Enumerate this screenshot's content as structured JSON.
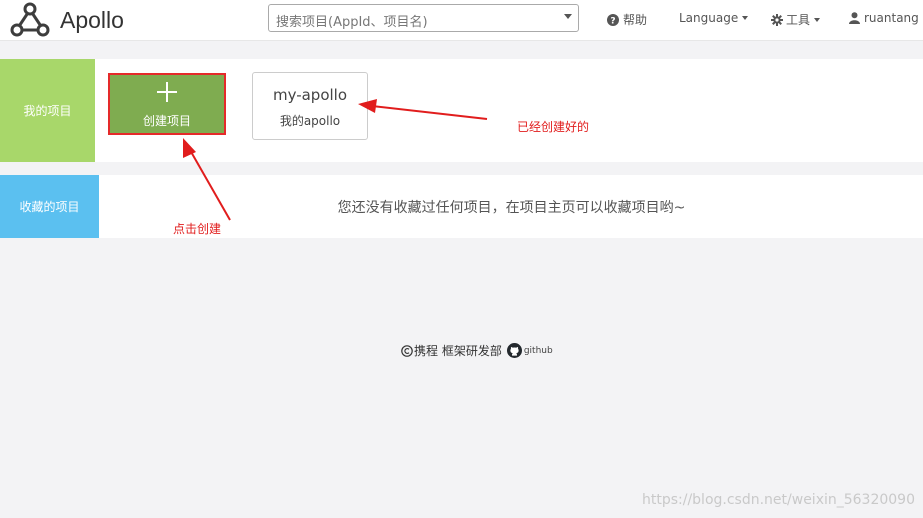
{
  "header": {
    "brand": "Apollo",
    "search_placeholder": "搜索项目(AppId、项目名)",
    "help_label": "帮助",
    "language_label": "Language",
    "tools_label": "工具",
    "user_label": "ruantang"
  },
  "my_projects": {
    "side_label": "我的项目",
    "create_label": "创建项目",
    "projects": [
      {
        "name": "my-apollo",
        "desc": "我的apollo"
      }
    ]
  },
  "favorites": {
    "side_label": "收藏的项目",
    "empty_message": "您还没有收藏过任何项目，在项目主页可以收藏项目哟~"
  },
  "annotations": {
    "created_note": "已经创建好的",
    "click_note": "点击创建"
  },
  "footer": {
    "text": "携程 框架研发部",
    "github": "github"
  },
  "watermark": "https://blog.csdn.net/weixin_56320090",
  "colors": {
    "my_projects_side": "#a8d76a",
    "favorites_side": "#5bc0f0",
    "create_button": "#7fac50",
    "annotation_red": "#e11d1d"
  }
}
